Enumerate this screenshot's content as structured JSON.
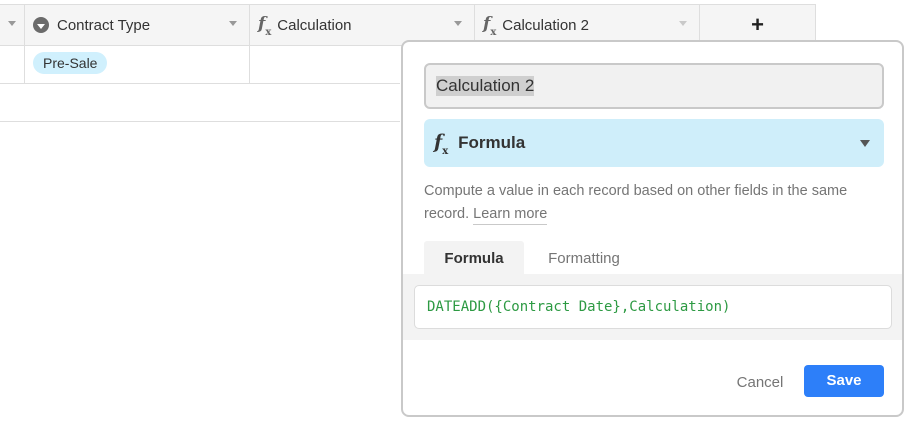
{
  "grid": {
    "columns": [
      {
        "name": "Contract Type",
        "icon": "single-select-icon"
      },
      {
        "name": "Calculation",
        "icon": "formula-icon"
      },
      {
        "name": "Calculation 2",
        "icon": "formula-icon"
      }
    ],
    "add_column_label": "+",
    "rows": [
      {
        "contract_type": "Pre-Sale"
      }
    ]
  },
  "dialog": {
    "field_name": "Calculation 2",
    "field_type": "Formula",
    "field_type_icon": "formula-icon",
    "description": "Compute a value in each record based on other fields in the same record.",
    "learn_more": "Learn more",
    "tabs": [
      {
        "label": "Formula",
        "active": true
      },
      {
        "label": "Formatting",
        "active": false
      }
    ],
    "formula": "DATEADD({Contract Date},Calculation)",
    "cancel_label": "Cancel",
    "save_label": "Save"
  },
  "colors": {
    "accent_blue": "#2d7ff9",
    "type_select_bg": "#cfeefa",
    "pill_bg": "#d0f0fd",
    "formula_text": "#2d9a43"
  }
}
